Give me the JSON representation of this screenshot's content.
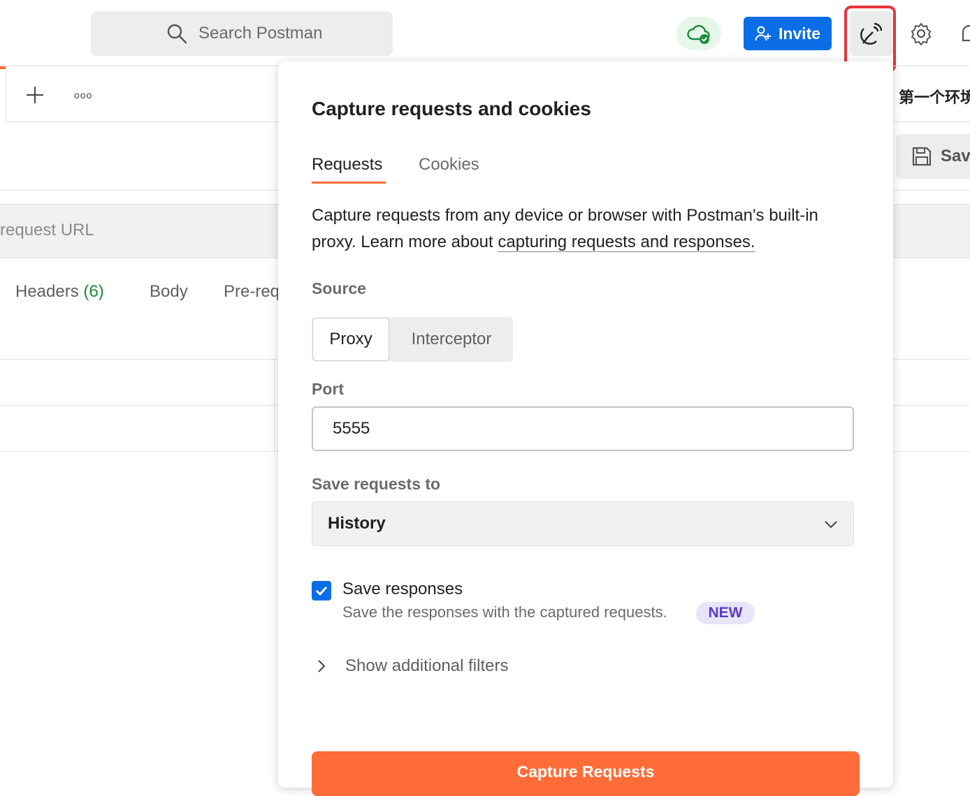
{
  "topbar": {
    "search_placeholder": "Search Postman",
    "invite_label": "Invite",
    "icons": [
      "search-icon",
      "cloud-sync-icon",
      "add-user-icon",
      "capture-icon",
      "gear-icon",
      "bell-icon"
    ]
  },
  "background": {
    "environment_name": "第一个环境",
    "save_label": "Save",
    "url_placeholder": "request URL",
    "tabs": [
      {
        "label": "Headers",
        "count": "(6)"
      },
      {
        "label": "Body"
      },
      {
        "label": "Pre-req"
      }
    ],
    "more_label": "ooo"
  },
  "popover": {
    "title": "Capture requests and cookies",
    "tabs": [
      {
        "label": "Requests",
        "active": true
      },
      {
        "label": "Cookies",
        "active": false
      }
    ],
    "description": "Capture requests from any device or browser with Postman's built-in proxy. Learn more about ",
    "description_link": "capturing requests and responses.",
    "source_label": "Source",
    "source_options": [
      "Proxy",
      "Interceptor"
    ],
    "source_selected": "Proxy",
    "port_label": "Port",
    "port_value": "5555",
    "save_to_label": "Save requests to",
    "save_to_value": "History",
    "save_responses": {
      "checked": true,
      "label": "Save responses",
      "description": "Save the responses with the captured requests.",
      "badge": "NEW"
    },
    "filters_label": "Show additional filters",
    "cta_label": "Capture Requests"
  },
  "colors": {
    "accent": "#ff6c37",
    "invite_blue": "#0b6ee6",
    "highlight_red": "#e8343b",
    "sync_green": "#1b8a3a"
  }
}
